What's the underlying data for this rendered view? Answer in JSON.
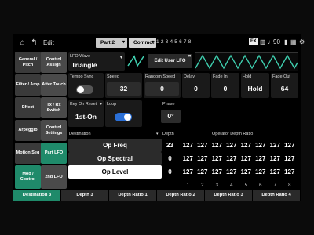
{
  "topbar": {
    "edit_label": "Edit",
    "part_tab": "Part 2",
    "common_tab": "Common",
    "part_numbers": "1 2 3 4 5 6 7 8",
    "fx_label": "FX",
    "tempo": "90"
  },
  "left_tabs": [
    {
      "label": "General / Pitch"
    },
    {
      "label": "Filter / Amp"
    },
    {
      "label": "Effect"
    },
    {
      "label": "Arpeggio"
    },
    {
      "label": "Motion Seq"
    },
    {
      "label": "Mod / Control"
    }
  ],
  "sub_tabs": [
    {
      "label": "Control Assign"
    },
    {
      "label": "After Touch"
    },
    {
      "label": "Tx / Rx Switch"
    },
    {
      "label": "Control Settings"
    },
    {
      "label": "Part LFO"
    },
    {
      "label": "2nd LFO"
    }
  ],
  "lfo_wave": {
    "label": "LFO Wave",
    "value": "Triangle"
  },
  "edit_user_lfo": "Edit User LFO",
  "params": {
    "tempo_sync": {
      "label": "Tempo Sync",
      "state": "off"
    },
    "speed": {
      "label": "Speed",
      "value": "32"
    },
    "random_speed": {
      "label": "Random Speed",
      "value": "0"
    },
    "delay": {
      "label": "Delay",
      "value": "0"
    },
    "fade_in": {
      "label": "Fade In",
      "value": "0"
    },
    "hold": {
      "label": "Hold",
      "value": "Hold"
    },
    "fade_out": {
      "label": "Fade Out",
      "value": "64"
    },
    "key_on_reset": {
      "label": "Key On Reset",
      "value": "1st-On"
    },
    "loop": {
      "label": "Loop",
      "state": "on"
    },
    "phase": {
      "label": "Phase",
      "value": "0°"
    }
  },
  "table": {
    "destination_header": "Destination",
    "depth_header": "Depth",
    "ratio_header": "Operator Depth Ratio",
    "rows": [
      {
        "destination": "Op Freq",
        "depth": "23",
        "ratios": [
          "127",
          "127",
          "127",
          "127",
          "127",
          "127",
          "127",
          "127"
        ]
      },
      {
        "destination": "Op Spectral",
        "depth": "0",
        "ratios": [
          "127",
          "127",
          "127",
          "127",
          "127",
          "127",
          "127",
          "127"
        ]
      },
      {
        "destination": "Op Level",
        "depth": "0",
        "ratios": [
          "127",
          "127",
          "127",
          "127",
          "127",
          "127",
          "127",
          "127"
        ]
      }
    ],
    "operator_numbers": [
      "1",
      "2",
      "3",
      "4",
      "5",
      "6",
      "7",
      "8"
    ]
  },
  "bottom_tabs": [
    {
      "label": "Destination 3"
    },
    {
      "label": "Depth 3"
    },
    {
      "label": "Depth Ratio 1"
    },
    {
      "label": "Depth Ratio 2"
    },
    {
      "label": "Depth Ratio 3"
    },
    {
      "label": "Depth Ratio 4"
    }
  ],
  "colors": {
    "accent": "#1f8a6a",
    "wave": "#3fd0b0",
    "toggle_on": "#2a6fd6"
  }
}
